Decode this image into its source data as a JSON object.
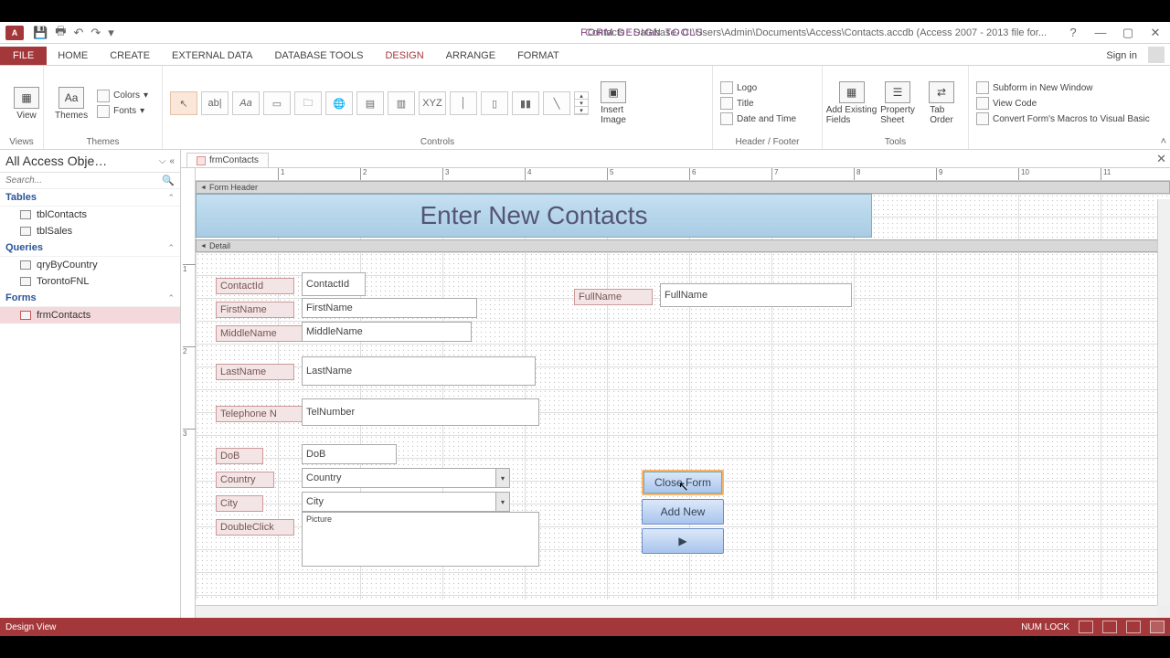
{
  "titlebar": {
    "context_title": "FORM DESIGN TOOLS",
    "doc_title": "Contacts : Database- C:\\Users\\Admin\\Documents\\Access\\Contacts.accdb (Access 2007 - 2013 file for...",
    "signin": "Sign in"
  },
  "tabs": {
    "file": "FILE",
    "items": [
      "HOME",
      "CREATE",
      "EXTERNAL DATA",
      "DATABASE TOOLS",
      "DESIGN",
      "ARRANGE",
      "FORMAT"
    ],
    "active": "DESIGN"
  },
  "ribbon": {
    "views": {
      "btn": "View",
      "group": "Views"
    },
    "themes": {
      "btn": "Themes",
      "colors": "Colors",
      "fonts": "Fonts",
      "group": "Themes"
    },
    "controls": {
      "group": "Controls"
    },
    "insert_image": {
      "btn": "Insert\nImage"
    },
    "header_footer": {
      "logo": "Logo",
      "title": "Title",
      "date": "Date and Time",
      "group": "Header / Footer"
    },
    "tools": {
      "existing": "Add Existing\nFields",
      "prop": "Property\nSheet",
      "taborder": "Tab\nOrder",
      "subform": "Subform in New Window",
      "viewcode": "View Code",
      "convert": "Convert Form's Macros to Visual Basic",
      "group": "Tools"
    }
  },
  "nav": {
    "title": "All Access Obje…",
    "search_placeholder": "Search...",
    "tables": {
      "label": "Tables",
      "items": [
        "tblContacts",
        "tblSales"
      ]
    },
    "queries": {
      "label": "Queries",
      "items": [
        "qryByCountry",
        "TorontoFNL"
      ]
    },
    "forms": {
      "label": "Forms",
      "items": [
        "frmContacts"
      ],
      "selected": "frmContacts"
    }
  },
  "doc": {
    "tab": "frmContacts",
    "form_header_section": "Form Header",
    "detail_section": "Detail",
    "title_text": "Enter New Contacts",
    "labels": {
      "contactid": "ContactId",
      "firstname": "FirstName",
      "middlename": "MiddleName",
      "lastname": "LastName",
      "telnumber": "Telephone N",
      "dob": "DoB",
      "country": "Country",
      "city": "City",
      "doubleclick": "DoubleClick",
      "fullname": "FullName"
    },
    "fields": {
      "contactid": "ContactId",
      "firstname": "FirstName",
      "middlename": "MiddleName",
      "lastname": "LastName",
      "telnumber": "TelNumber",
      "dob": "DoB",
      "country": "Country",
      "city": "City",
      "picture": "Picture",
      "fullname": "FullName"
    },
    "buttons": {
      "close": "Close Form",
      "addnew": "Add New",
      "next": "▶"
    },
    "ruler_ticks": [
      "1",
      "2",
      "3",
      "4",
      "5",
      "6",
      "7",
      "8",
      "9",
      "10",
      "11"
    ],
    "vruler_ticks": [
      "1",
      "2",
      "3"
    ]
  },
  "status": {
    "mode": "Design View",
    "numlock": "NUM LOCK"
  }
}
